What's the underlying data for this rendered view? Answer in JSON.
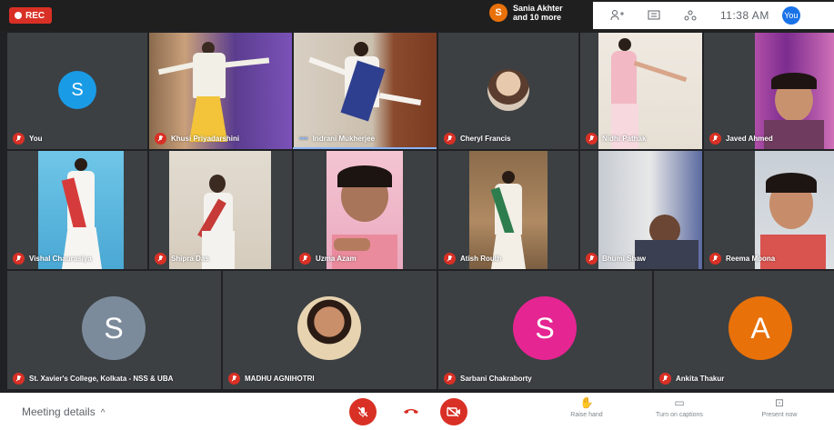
{
  "top": {
    "rec_label": "REC",
    "presenter_initial": "S",
    "presenter_line1": "Sania Akhter",
    "presenter_line2": "and 10 more",
    "clock": "11:38 AM",
    "self_initial": "You"
  },
  "row1": [
    {
      "name": "You"
    },
    {
      "name": "Khusi Priyadarshini"
    },
    {
      "name": "Indrani Mukherjee"
    },
    {
      "name": "Cheryl Francis"
    },
    {
      "name": "Nidhi Pathak"
    },
    {
      "name": "Javed Ahmed"
    }
  ],
  "row1_you_initial": "S",
  "row2": [
    {
      "name": "Vishal Chaurasiya"
    },
    {
      "name": "Shipra Das"
    },
    {
      "name": "Uzma Azam"
    },
    {
      "name": "Atish Routh"
    },
    {
      "name": "Bhumi Shaw"
    },
    {
      "name": "Reema Moona"
    }
  ],
  "row3": [
    {
      "name": "St. Xavier's College, Kolkata - NSS & UBA",
      "initial": "S",
      "color": "#7c8b9c"
    },
    {
      "name": "MADHU AGNIHOTRI",
      "initial": "",
      "color": "#e4c79a"
    },
    {
      "name": "Sarbani Chakraborty",
      "initial": "S",
      "color": "#e52592"
    },
    {
      "name": "Ankita Thakur",
      "initial": "A",
      "color": "#e8710a"
    }
  ],
  "bottom": {
    "meeting_details": "Meeting details",
    "raise_hand": "Raise hand",
    "captions": "Turn on captions",
    "present": "Present now"
  },
  "colors": {
    "accent": "#1a73e8",
    "danger": "#d93025",
    "tile": "#3c4043",
    "background": "#202124"
  }
}
